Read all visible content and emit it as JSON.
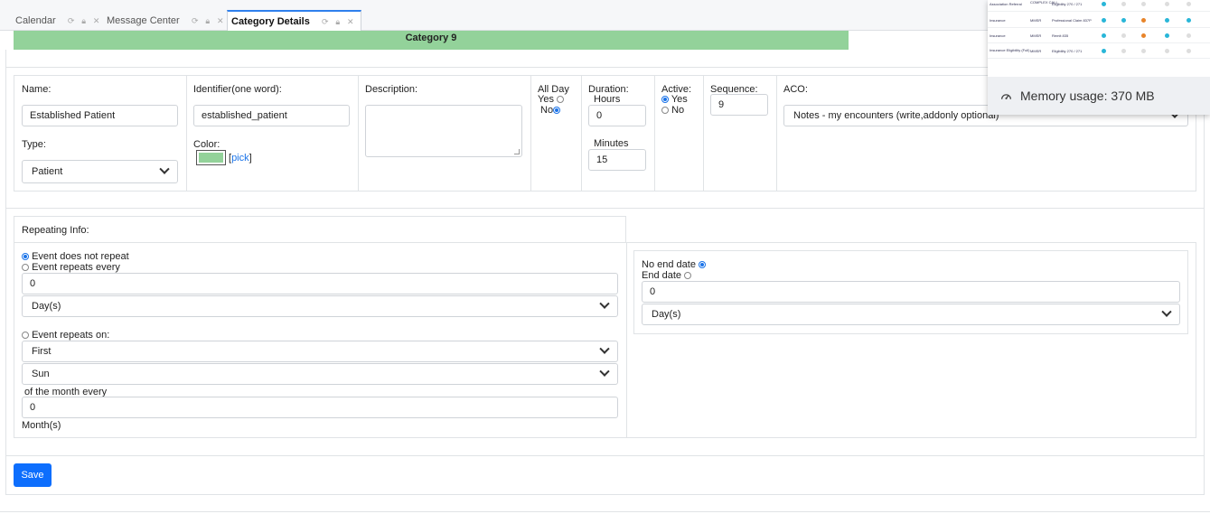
{
  "tabs": [
    {
      "label": "Calendar",
      "active": false
    },
    {
      "label": "Message Center",
      "active": false
    },
    {
      "label": "Category Details",
      "active": true
    }
  ],
  "category": {
    "title": "Category 9"
  },
  "form": {
    "name_label": "Name:",
    "name_value": "Established Patient",
    "type_label": "Type:",
    "type_value": "Patient",
    "identifier_label": "Identifier(one word):",
    "identifier_value": "established_patient",
    "color_label": "Color:",
    "color_hex": "#93d29a",
    "pick_link": "pick",
    "description_label": "Description:",
    "all_day_label": "All Day",
    "yes_label": "Yes",
    "no_label": "No",
    "all_day_value": "No",
    "duration_label": "Duration:",
    "hours_label": "Hours",
    "hours_value": "0",
    "minutes_label": "Minutes",
    "minutes_value": "15",
    "active_label": "Active:",
    "active_value": "Yes",
    "sequence_label": "Sequence:",
    "sequence_value": "9",
    "aco_label": "ACO:",
    "aco_value": "Notes - my encounters (write,addonly optional)"
  },
  "repeating": {
    "title": "Repeating Info:",
    "no_repeat_label": "Event does not repeat",
    "repeats_every_label": "Event repeats every",
    "repeat_every_value": "0",
    "repeat_unit": "Day(s)",
    "repeats_on_label": "Event repeats on:",
    "repeat_on_ordinal": "First",
    "repeat_on_day": "Sun",
    "of_month_label": "of the month every",
    "month_every_value": "0",
    "months_label": "Month(s)",
    "no_end_label": "No end date",
    "end_date_label": "End date",
    "end_date_value": "0",
    "end_unit": "Day(s)",
    "selected": "Event does not repeat",
    "end_selected": "No end date"
  },
  "save_label": "Save",
  "overlay": {
    "rows": [
      {
        "c1": "Association Referral",
        "c2": "COMPLEX CALL",
        "c3": "Eligibility   270 / 271"
      },
      {
        "c1": "Insurance",
        "c2": "MMSR",
        "c3": "Professional Claim   837P"
      },
      {
        "c1": "Insurance",
        "c2": "MMSR",
        "c3": "Remit   835"
      },
      {
        "c1": "Insurance Eligibility (Full)",
        "c2": "MMSR",
        "c3": "Eligibility   270 / 271"
      }
    ],
    "memory_label": "Memory usage: 370 MB"
  },
  "colors": {
    "accent": "#1a73e8",
    "header_green": "#93d29a",
    "save_button": "#0d6efd"
  }
}
